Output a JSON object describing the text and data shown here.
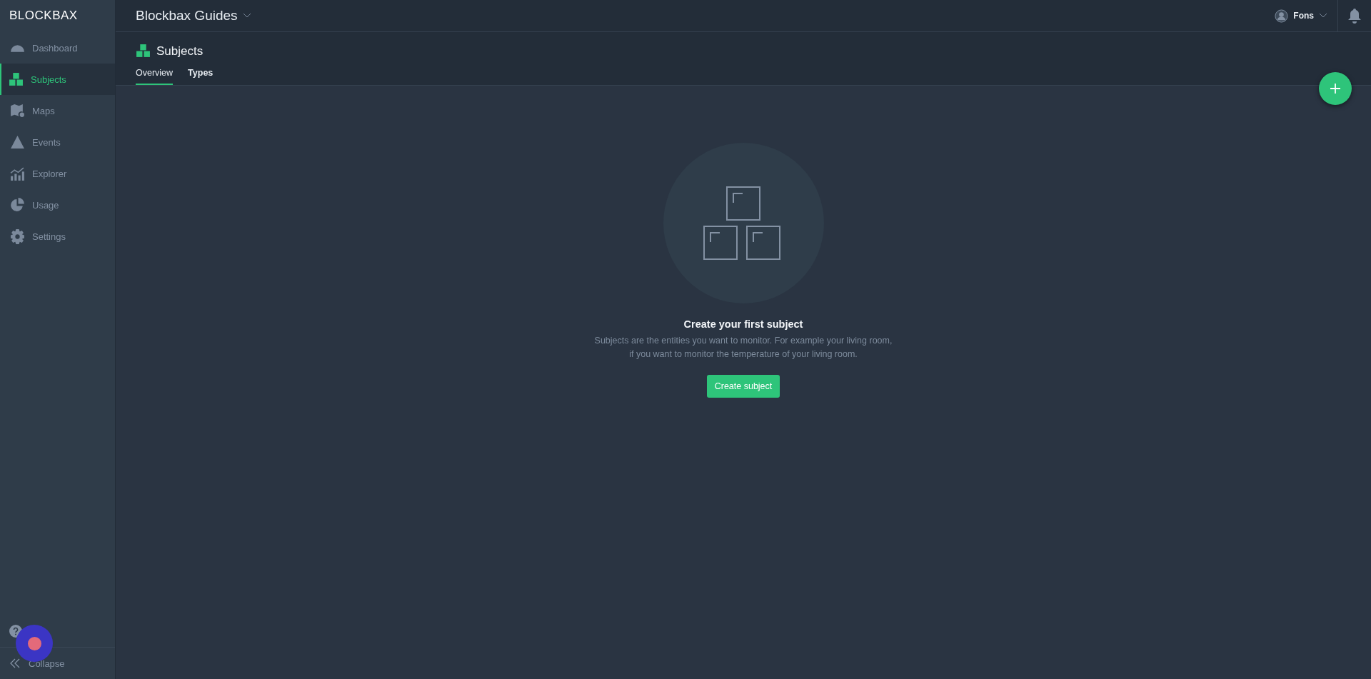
{
  "logo": {
    "text": "BLOCKBAX"
  },
  "project": {
    "name": "Blockbax Guides"
  },
  "user": {
    "name": "Fons"
  },
  "sidebar": {
    "items": [
      {
        "label": "Dashboard",
        "kind": "dashboard",
        "selected": false
      },
      {
        "label": "Subjects",
        "kind": "subjects",
        "selected": true
      },
      {
        "label": "Maps",
        "kind": "maps",
        "selected": false
      },
      {
        "label": "Events",
        "kind": "events",
        "selected": false
      },
      {
        "label": "Explorer",
        "kind": "explorer",
        "selected": false
      },
      {
        "label": "Usage",
        "kind": "usage",
        "selected": false
      },
      {
        "label": "Settings",
        "kind": "settings",
        "selected": false
      }
    ],
    "collapse": "Collapse"
  },
  "page": {
    "title": "Subjects",
    "tabs": [
      {
        "label": "Overview",
        "selected": true
      },
      {
        "label": "Types",
        "selected": false
      }
    ]
  },
  "empty_state": {
    "title": "Create your first subject",
    "text": "Subjects are the entities you want to monitor. For example your living room, if you want to monitor the temperature of your living room.",
    "button": "Create subject"
  }
}
